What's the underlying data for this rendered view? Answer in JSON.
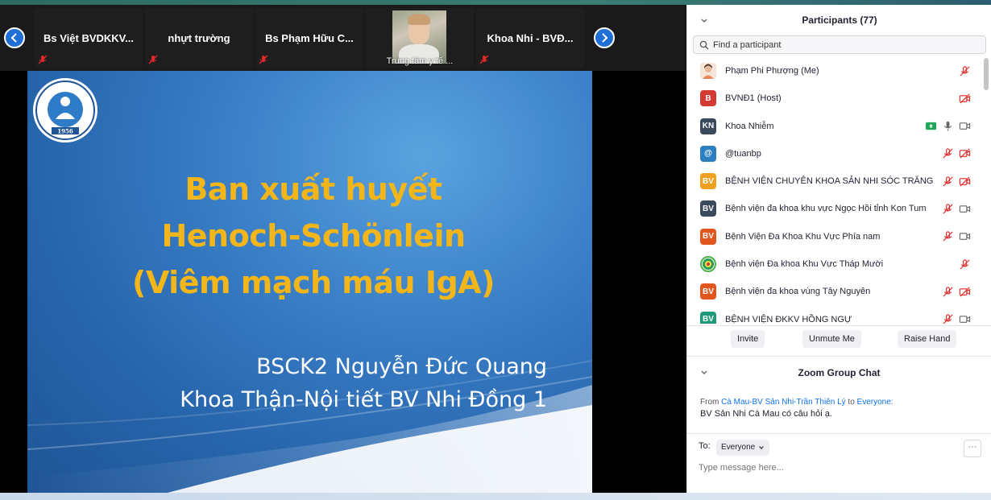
{
  "thumbnails": [
    {
      "name": "Bs Việt BVDKKV..."
    },
    {
      "name": "nhựt trường"
    },
    {
      "name": "Bs Phạm Hữu C..."
    },
    {
      "name": "Trung tâm y tế ..."
    },
    {
      "name": "Khoa Nhi - BVĐ..."
    }
  ],
  "slide": {
    "title_line1": "Ban xuất huyết",
    "title_line2": "Henoch-Schönlein",
    "title_line3": "(Viêm mạch máu IgA)",
    "author_line1": "BSCK2 Nguyễn Đức Quang",
    "author_line2": "Khoa Thận-Nội tiết BV Nhi Đồng 1",
    "logo_text": "BỆNH VIỆN NHI ĐỒNG 1",
    "logo_year": "1956"
  },
  "participants": {
    "title": "Participants (77)",
    "search_placeholder": "Find a participant",
    "items": [
      {
        "avatar": "",
        "name": "Phạm Phi Phượng (Me)",
        "color": "#f3d9c6"
      },
      {
        "avatar": "B",
        "name": "BVNĐ1 (Host)",
        "color": "#d33a32"
      },
      {
        "avatar": "KN",
        "name": "Khoa Nhiễm",
        "color": "#3a4a5c"
      },
      {
        "avatar": "@",
        "name": "@tuanbp",
        "color": "#2d7fc1"
      },
      {
        "avatar": "BV",
        "name": "BỆNH VIỆN CHUYÊN KHOA SẢN NHI SÓC TRĂNG",
        "color": "#f0a020"
      },
      {
        "avatar": "BV",
        "name": "Bệnh viện đa khoa khu vực Ngọc Hồi tỉnh Kon Tum",
        "color": "#3a4a5c"
      },
      {
        "avatar": "BV",
        "name": "Bệnh Viện Đa Khoa Khu Vực Phía nam",
        "color": "#e0561c"
      },
      {
        "avatar": "",
        "name": "Bệnh viện Đa khoa Khu Vực Tháp Mười",
        "color": "#4caf50"
      },
      {
        "avatar": "BV",
        "name": "Bệnh viện đa khoa vùng Tây Nguyên",
        "color": "#e0561c"
      },
      {
        "avatar": "BV",
        "name": "BỆNH VIỆN ĐKKV HỒNG NGỰ",
        "color": "#1e9a7a"
      }
    ],
    "invite": "Invite",
    "unmute": "Unmute Me",
    "raise_hand": "Raise Hand"
  },
  "chat": {
    "title": "Zoom Group Chat",
    "from_label": "From",
    "from_name": "Cà Mau-BV Sản Nhi-Trần Thiên Lý",
    "to_label": "to",
    "to_name": "Everyone:",
    "message": "BV Sản Nhi Cà Mau có câu hỏi ạ.",
    "to_prefix": "To:",
    "recipient": "Everyone",
    "more": "···",
    "input_placeholder": "Type message here..."
  }
}
